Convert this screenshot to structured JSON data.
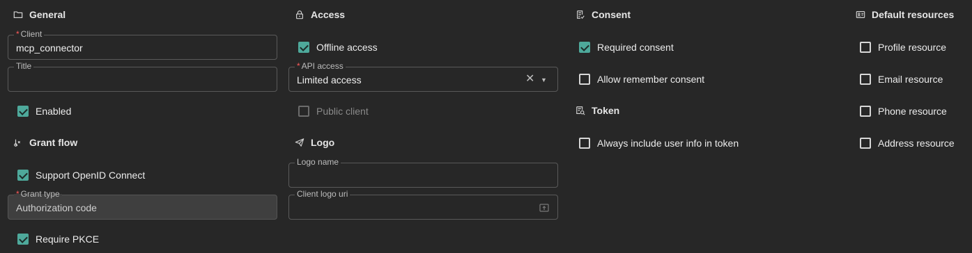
{
  "general": {
    "title": "General",
    "client": {
      "label": "Client",
      "required": "*",
      "value": "mcp_connector"
    },
    "title_field": {
      "label": "Title",
      "value": ""
    },
    "enabled": {
      "label": "Enabled",
      "checked": true
    }
  },
  "grant_flow": {
    "title": "Grant flow",
    "support_openid": {
      "label": "Support OpenID Connect",
      "checked": true
    },
    "grant_type": {
      "label": "Grant type",
      "required": "*",
      "value": "Authorization code"
    },
    "require_pkce": {
      "label": "Require PKCE",
      "checked": true
    }
  },
  "access": {
    "title": "Access",
    "offline_access": {
      "label": "Offline access",
      "checked": true
    },
    "api_access": {
      "label": "API access",
      "required": "*",
      "value": "Limited access"
    },
    "public_client": {
      "label": "Public client",
      "checked": false,
      "disabled": true
    }
  },
  "logo": {
    "title": "Logo",
    "logo_name": {
      "label": "Logo name",
      "value": ""
    },
    "client_logo_uri": {
      "label": "Client logo uri",
      "value": ""
    }
  },
  "consent": {
    "title": "Consent",
    "required_consent": {
      "label": "Required consent",
      "checked": true
    },
    "allow_remember": {
      "label": "Allow remember consent",
      "checked": false
    }
  },
  "token": {
    "title": "Token",
    "always_include_user_info": {
      "label": "Always include user info in token",
      "checked": false
    }
  },
  "default_resources": {
    "title": "Default resources",
    "items": [
      {
        "label": "Profile resource",
        "checked": false
      },
      {
        "label": "Email resource",
        "checked": false
      },
      {
        "label": "Phone resource",
        "checked": false
      },
      {
        "label": "Address resource",
        "checked": false
      }
    ]
  },
  "colors": {
    "accent": "#4ea99b",
    "background": "#272727",
    "required": "#ff5a5a"
  },
  "icons": [
    "folder-icon",
    "lock-icon",
    "consent-icon",
    "id-card-icon",
    "flow-icon",
    "send-icon",
    "token-icon",
    "clear-icon",
    "dropdown-arrow-icon",
    "upload-icon"
  ]
}
